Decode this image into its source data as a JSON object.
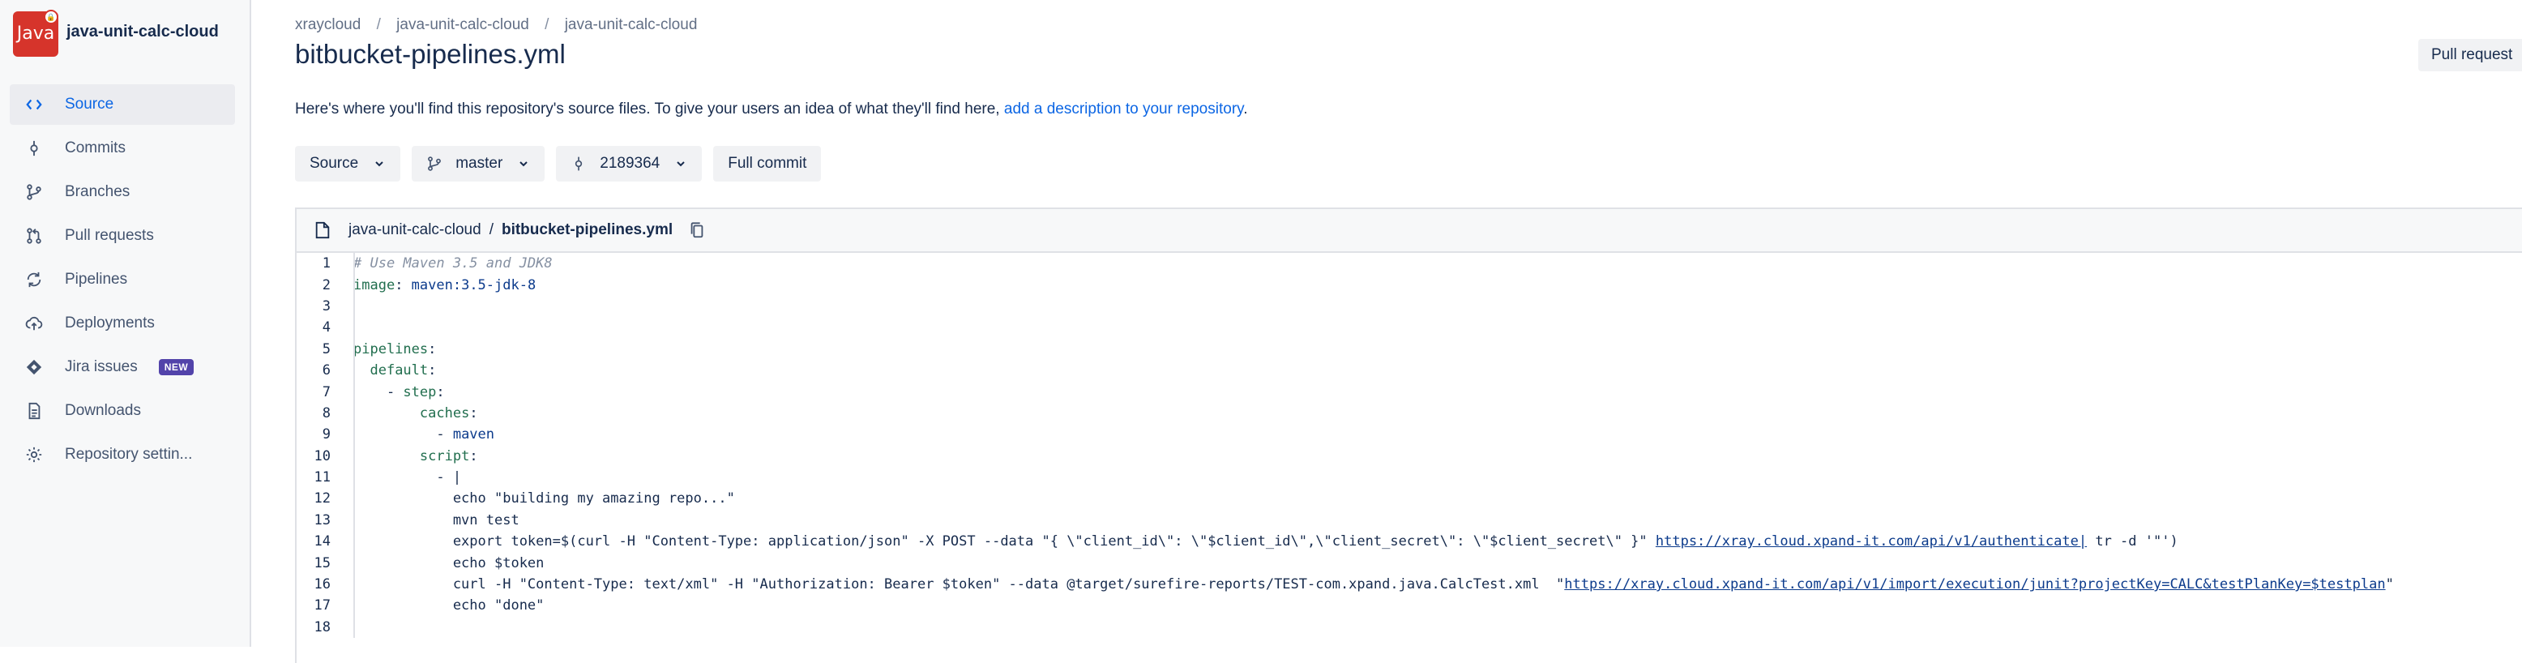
{
  "repo": {
    "name": "java-unit-calc-cloud",
    "avatar_text": "Java",
    "avatar_color": "#d6342b"
  },
  "sidebar": {
    "items": [
      {
        "label": "Source",
        "icon": "code-icon",
        "active": true
      },
      {
        "label": "Commits",
        "icon": "commit-icon",
        "active": false
      },
      {
        "label": "Branches",
        "icon": "branch-icon",
        "active": false
      },
      {
        "label": "Pull requests",
        "icon": "pull-request-icon",
        "active": false
      },
      {
        "label": "Pipelines",
        "icon": "pipelines-icon",
        "active": false
      },
      {
        "label": "Deployments",
        "icon": "deployments-icon",
        "active": false
      },
      {
        "label": "Jira issues",
        "icon": "jira-icon",
        "active": false,
        "badge": "NEW"
      },
      {
        "label": "Downloads",
        "icon": "downloads-icon",
        "active": false
      },
      {
        "label": "Repository settin...",
        "icon": "gear-icon",
        "active": false
      }
    ]
  },
  "header": {
    "breadcrumb": [
      "xraycloud",
      "java-unit-calc-cloud",
      "java-unit-calc-cloud"
    ],
    "title": "bitbucket-pipelines.yml",
    "pull_request_label": "Pull request"
  },
  "description": {
    "text": "Here's where you'll find this repository's source files. To give your users an idea of what they'll find here, ",
    "link": "add a description to your repository",
    "suffix": "."
  },
  "toolbar": {
    "source_label": "Source",
    "branch_label": "master",
    "commit_label": "2189364",
    "full_commit_label": "Full commit"
  },
  "file": {
    "repo": "java-unit-calc-cloud",
    "separator": "/",
    "name": "bitbucket-pipelines.yml",
    "lines": [
      [
        [
          "comment",
          "# Use Maven 3.5 and JDK8"
        ]
      ],
      [
        [
          "key",
          "image"
        ],
        [
          "plain",
          ": "
        ],
        [
          "val",
          "maven:3.5-jdk-8"
        ]
      ],
      [],
      [],
      [
        [
          "key",
          "pipelines"
        ],
        [
          "plain",
          ":"
        ]
      ],
      [
        [
          "plain",
          "  "
        ],
        [
          "key",
          "default"
        ],
        [
          "plain",
          ":"
        ]
      ],
      [
        [
          "plain",
          "    - "
        ],
        [
          "key",
          "step"
        ],
        [
          "plain",
          ":"
        ]
      ],
      [
        [
          "plain",
          "        "
        ],
        [
          "key",
          "caches"
        ],
        [
          "plain",
          ":"
        ]
      ],
      [
        [
          "plain",
          "          - "
        ],
        [
          "val",
          "maven"
        ]
      ],
      [
        [
          "plain",
          "        "
        ],
        [
          "key",
          "script"
        ],
        [
          "plain",
          ":"
        ]
      ],
      [
        [
          "plain",
          "          - |"
        ]
      ],
      [
        [
          "plain",
          "            echo \"building my amazing repo...\""
        ]
      ],
      [
        [
          "plain",
          "            mvn test"
        ]
      ],
      [
        [
          "plain",
          "            export token=$(curl -H \"Content-Type: application/json\" -X POST --data \"{ \\\"client_id\\\": \\\"$client_id\\\",\\\"client_secret\\\": \\\"$client_secret\\\" }\" "
        ],
        [
          "link",
          "https://xray.cloud.xpand-it.com/api/v1/authenticate|"
        ],
        [
          "plain",
          " tr -d '\"')"
        ]
      ],
      [
        [
          "plain",
          "            echo $token"
        ]
      ],
      [
        [
          "plain",
          "            curl -H \"Content-Type: text/xml\" -H \"Authorization: Bearer $token\" --data @target/surefire-reports/TEST-com.xpand.java.CalcTest.xml  \""
        ],
        [
          "link",
          "https://xray.cloud.xpand-it.com/api/v1/import/execution/junit?projectKey=CALC&testPlanKey=$testplan"
        ],
        [
          "plain",
          "\""
        ]
      ],
      [
        [
          "plain",
          "            echo \"done\""
        ]
      ],
      []
    ]
  }
}
